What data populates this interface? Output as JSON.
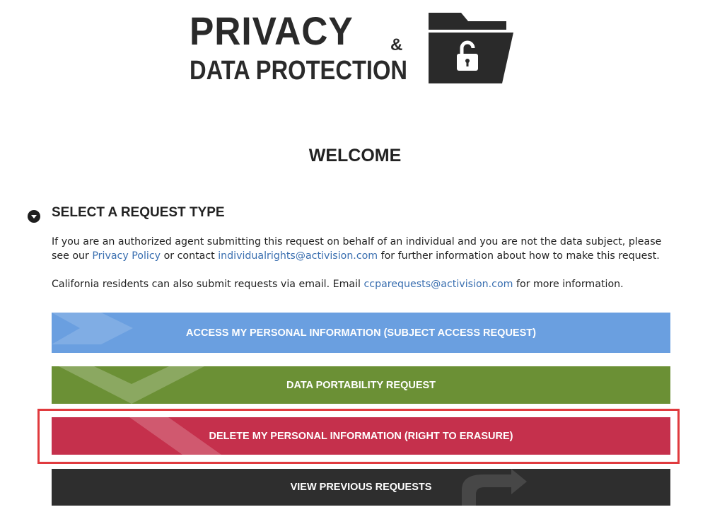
{
  "header": {
    "logo_line1": "PRIVACY",
    "logo_amp": "&",
    "logo_line2": "DATA PROTECTION"
  },
  "main": {
    "welcome": "WELCOME",
    "section_title": "SELECT A REQUEST TYPE",
    "para1": {
      "text_a": "If you are an authorized agent submitting this request on behalf of an individual and you are not the data subject, please see our ",
      "privacy_link": "Privacy Policy",
      "text_b": " or contact ",
      "email_link": "individualrights@activision.com",
      "text_c": " for further information about how to make this request."
    },
    "para2": {
      "text_a": "California residents can also submit requests via email. Email ",
      "email_link": "ccparequests@activision.com",
      "text_b": " for more information."
    },
    "buttons": {
      "access": "ACCESS MY PERSONAL INFORMATION (SUBJECT ACCESS REQUEST)",
      "portability": "DATA PORTABILITY REQUEST",
      "delete": "DELETE MY PERSONAL INFORMATION (RIGHT TO ERASURE)",
      "view": "VIEW PREVIOUS REQUESTS"
    }
  },
  "colors": {
    "access": "#6a9fe0",
    "portability": "#6b9035",
    "delete": "#c5304c",
    "view": "#2e2e2e",
    "link": "#3a6fb0",
    "highlight": "#e03a3e"
  },
  "icons": {
    "logo": "folder-lock-icon",
    "toggle": "chevron-down-circle-icon"
  }
}
